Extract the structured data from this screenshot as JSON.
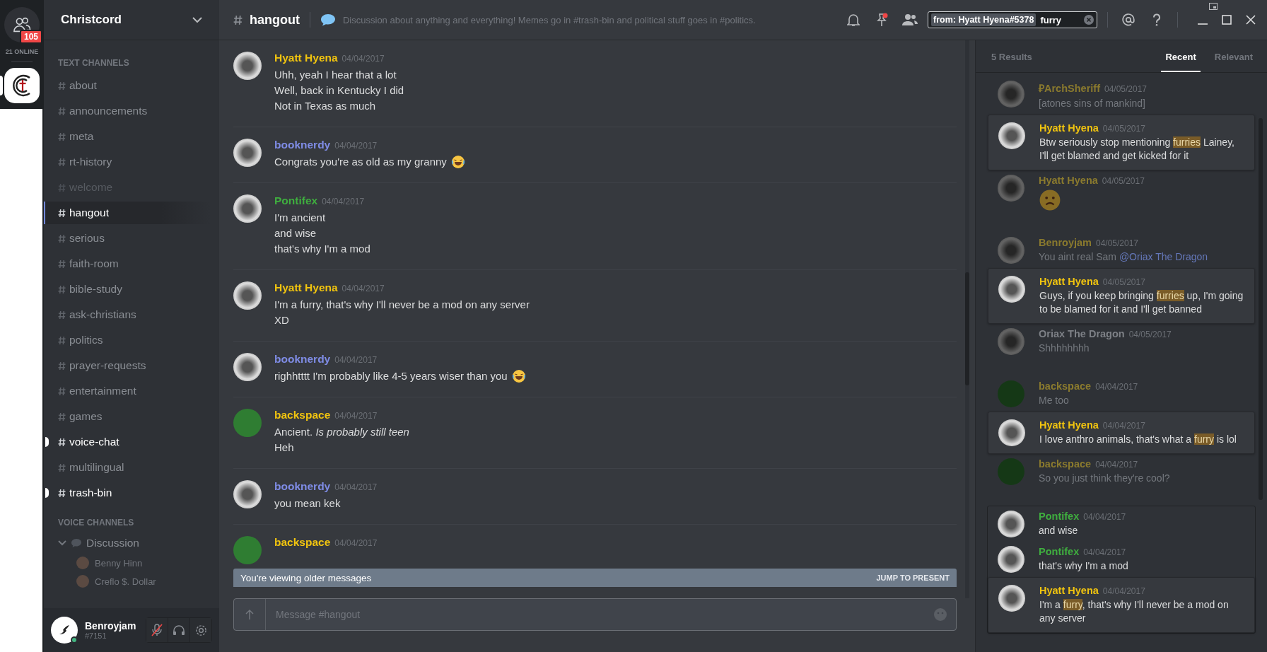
{
  "servers": {
    "badge": "105",
    "online": "21 ONLINE",
    "server_selected": true
  },
  "server_name": "Christcord",
  "text_channels_label": "TEXT CHANNELS",
  "text_channels": [
    {
      "name": "about",
      "selected": false,
      "unread": false,
      "muted": false
    },
    {
      "name": "announcements",
      "selected": false,
      "unread": false,
      "muted": false
    },
    {
      "name": "meta",
      "selected": false,
      "unread": false,
      "muted": false
    },
    {
      "name": "rt-history",
      "selected": false,
      "unread": false,
      "muted": false
    },
    {
      "name": "welcome",
      "selected": false,
      "unread": false,
      "muted": true
    },
    {
      "name": "hangout",
      "selected": true,
      "unread": false,
      "muted": false
    },
    {
      "name": "serious",
      "selected": false,
      "unread": false,
      "muted": false
    },
    {
      "name": "faith-room",
      "selected": false,
      "unread": false,
      "muted": false
    },
    {
      "name": "bible-study",
      "selected": false,
      "unread": false,
      "muted": false
    },
    {
      "name": "ask-christians",
      "selected": false,
      "unread": false,
      "muted": false
    },
    {
      "name": "politics",
      "selected": false,
      "unread": false,
      "muted": false
    },
    {
      "name": "prayer-requests",
      "selected": false,
      "unread": false,
      "muted": false
    },
    {
      "name": "entertainment",
      "selected": false,
      "unread": false,
      "muted": false
    },
    {
      "name": "games",
      "selected": false,
      "unread": false,
      "muted": false
    },
    {
      "name": "voice-chat",
      "selected": false,
      "unread": true,
      "muted": false
    },
    {
      "name": "multilingual",
      "selected": false,
      "unread": false,
      "muted": false
    },
    {
      "name": "trash-bin",
      "selected": false,
      "unread": true,
      "muted": false
    }
  ],
  "voice_channels_label": "VOICE CHANNELS",
  "voice_channels": [
    {
      "name": "Discussion",
      "expanded": true,
      "members": [
        {
          "name": "Benny Hinn"
        },
        {
          "name": "Creflo $. Dollar"
        }
      ]
    }
  ],
  "user": {
    "name": "Benroyjam",
    "tag": "#7151",
    "mic_muted": true
  },
  "header": {
    "channel": "hangout",
    "topic": "Discussion about anything and everything! Memes go in #trash-bin and political stuff goes in #politics.",
    "pin_unread": true
  },
  "search": {
    "filter": "from: Hyatt Hyena#5378",
    "query": "furry"
  },
  "messages": [
    {
      "author": "Hyatt Hyena",
      "color": "#f1c40f",
      "kind": "photo",
      "date": "04/04/2017",
      "lines": [
        {
          "text": "Uhh, yeah I hear that a lot"
        },
        {
          "text": "Well, back in Kentucky I did"
        },
        {
          "text": "Not in Texas as much"
        }
      ]
    },
    {
      "author": "booknerdy",
      "color": "#7f8ce6",
      "kind": "photo",
      "date": "04/04/2017",
      "lines": [
        {
          "text": "Congrats you're as old as my granny",
          "emoji": true
        }
      ]
    },
    {
      "author": "Pontifex",
      "color": "#3fae3f",
      "kind": "photo",
      "date": "04/04/2017",
      "lines": [
        {
          "text": "I'm ancient"
        },
        {
          "text": "and wise"
        },
        {
          "text": "that's why I'm a mod"
        }
      ]
    },
    {
      "author": "Hyatt Hyena",
      "color": "#f1c40f",
      "kind": "photo",
      "date": "04/04/2017",
      "lines": [
        {
          "text": "I'm a furry, that's why I'll never be a mod on any server"
        },
        {
          "text": "XD"
        }
      ]
    },
    {
      "author": "booknerdy",
      "color": "#7f8ce6",
      "kind": "photo",
      "date": "04/04/2017",
      "lines": [
        {
          "text": "righhtttt I'm probably like 4-5 years wiser than you",
          "emoji": true
        }
      ]
    },
    {
      "author": "backspace",
      "color": "#f1c40f",
      "kind": "default",
      "date": "04/04/2017",
      "lines": [
        {
          "text": "Ancient. *Is probably still teen*"
        },
        {
          "text": "Heh"
        }
      ]
    },
    {
      "author": "booknerdy",
      "color": "#7f8ce6",
      "kind": "photo",
      "date": "04/04/2017",
      "lines": [
        {
          "text": "you mean kek"
        }
      ]
    },
    {
      "author": "backspace",
      "color": "#f1c40f",
      "kind": "default",
      "date": "04/04/2017"
    }
  ],
  "older_banner": {
    "text": "You're viewing older messages",
    "action": "JUMP TO PRESENT"
  },
  "composer": {
    "placeholder": "Message #hangout"
  },
  "results_panel": {
    "count": "5 Results",
    "tabs": [
      {
        "label": "Recent",
        "selected": true
      },
      {
        "label": "Relevant",
        "selected": false
      }
    ]
  },
  "results": [
    {
      "hovered": false,
      "messages": [
        {
          "author": "₽ArchSheriff",
          "color": "#8a7a2e",
          "kind": "photo",
          "date": "04/05/2017",
          "hit": false,
          "segments": [
            {
              "text": "[atones sins of mankind]",
              "kind": "plain"
            }
          ]
        },
        {
          "author": "Hyatt Hyena",
          "color": "#f1c40f",
          "kind": "photo",
          "date": "04/05/2017",
          "hit": true,
          "segments": [
            {
              "text": "Btw seriously stop mentioning ",
              "kind": "plain"
            },
            {
              "text": "furries",
              "kind": "highlight"
            },
            {
              "text": " Lainey, I'll get blamed and get kicked for it",
              "kind": "plain"
            }
          ]
        },
        {
          "author": "Hyatt Hyena",
          "color": "#8a7a2e",
          "kind": "photo",
          "date": "04/05/2017",
          "hit": false,
          "emoji": true
        }
      ]
    },
    {
      "hovered": false,
      "messages": [
        {
          "author": "Benroyjam",
          "color": "#8a7a2e",
          "kind": "photo",
          "date": "04/05/2017",
          "hit": false,
          "segments": [
            {
              "text": "You aint real Sam ",
              "kind": "plain"
            },
            {
              "text": "@Oriax The Dragon",
              "kind": "mention"
            }
          ]
        },
        {
          "author": "Hyatt Hyena",
          "color": "#f1c40f",
          "kind": "photo",
          "date": "04/05/2017",
          "hit": true,
          "segments": [
            {
              "text": "Guys, if you keep bringing ",
              "kind": "plain"
            },
            {
              "text": "furries",
              "kind": "highlight"
            },
            {
              "text": " up, I'm going to be blamed for it and I'll get banned",
              "kind": "plain"
            }
          ]
        },
        {
          "author": "Oriax The Dragon",
          "color": "#7d8086",
          "kind": "photo",
          "date": "04/05/2017",
          "hit": false,
          "segments": [
            {
              "text": "Shhhhhhhh",
              "kind": "plain"
            }
          ]
        }
      ]
    },
    {
      "hovered": false,
      "messages": [
        {
          "author": "backspace",
          "color": "#8a7a2e",
          "kind": "default",
          "date": "04/04/2017",
          "hit": false,
          "segments": [
            {
              "text": "Me too",
              "kind": "plain"
            }
          ]
        },
        {
          "author": "Hyatt Hyena",
          "color": "#f1c40f",
          "kind": "photo",
          "date": "04/04/2017",
          "hit": true,
          "segments": [
            {
              "text": "I love anthro animals, that's what a ",
              "kind": "plain"
            },
            {
              "text": "furry",
              "kind": "highlight"
            },
            {
              "text": " is lol",
              "kind": "plain"
            }
          ]
        },
        {
          "author": "backspace",
          "color": "#8a7a2e",
          "kind": "default",
          "date": "04/04/2017",
          "hit": false,
          "segments": [
            {
              "text": "So you just think they're cool?",
              "kind": "plain"
            }
          ]
        }
      ]
    },
    {
      "hovered": true,
      "messages": [
        {
          "author": "Pontifex",
          "color": "#3fae3f",
          "kind": "photo",
          "date": "04/04/2017",
          "hit": false,
          "segments": [
            {
              "text": "and wise",
              "kind": "plain"
            }
          ]
        },
        {
          "author": "Pontifex",
          "color": "#3fae3f",
          "kind": "photo",
          "date": "04/04/2017",
          "hit": false,
          "segments": [
            {
              "text": "that's why I'm a mod",
              "kind": "plain"
            }
          ]
        },
        {
          "author": "Hyatt Hyena",
          "color": "#f1c40f",
          "kind": "photo",
          "date": "04/04/2017",
          "hit": true,
          "segments": [
            {
              "text": "I'm a ",
              "kind": "plain"
            },
            {
              "text": "furry",
              "kind": "highlight"
            },
            {
              "text": ", that's why I'll never be a mod on any server",
              "kind": "plain"
            }
          ]
        }
      ]
    }
  ]
}
